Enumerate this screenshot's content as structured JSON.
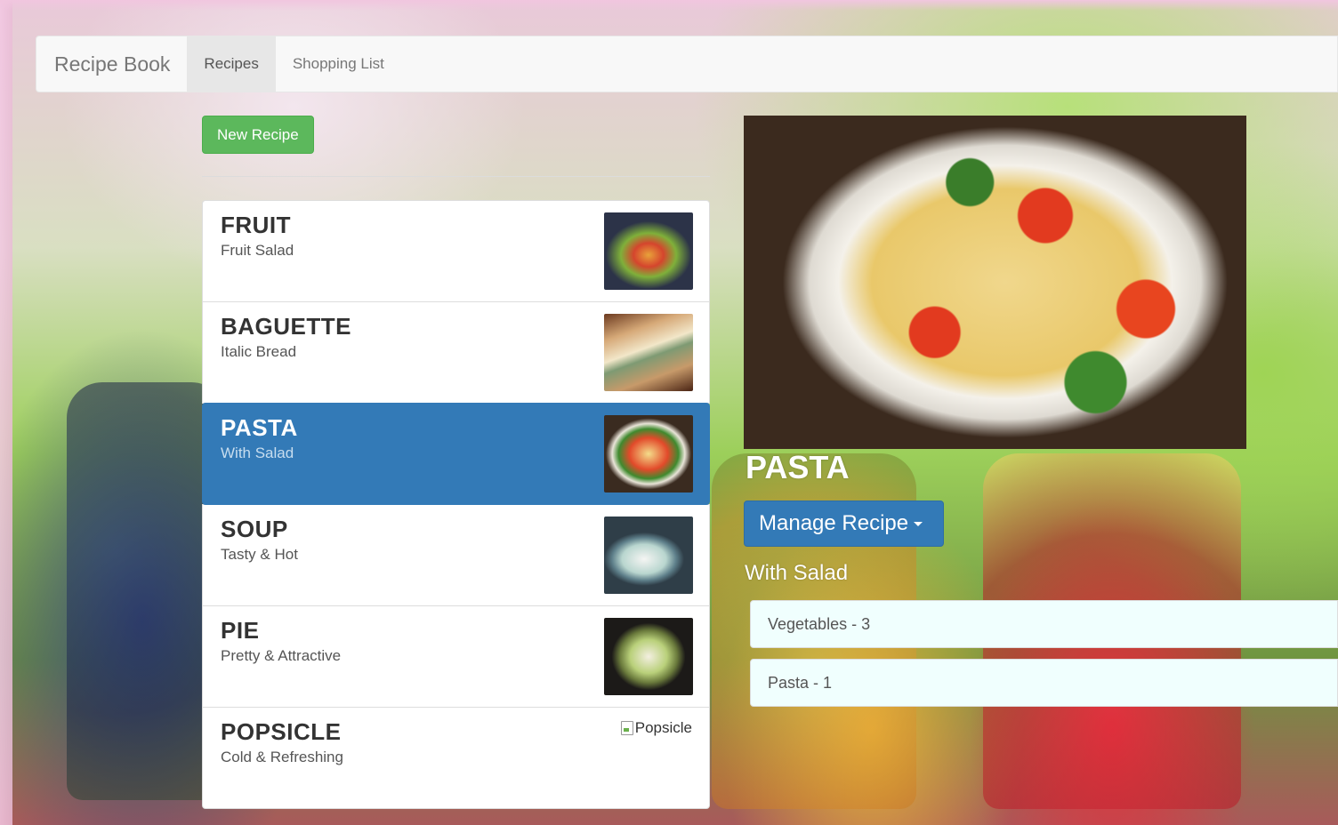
{
  "navbar": {
    "brand": "Recipe Book",
    "links": [
      {
        "label": "Recipes",
        "active": true
      },
      {
        "label": "Shopping List",
        "active": false
      }
    ]
  },
  "recipes_panel": {
    "new_button_label": "New Recipe",
    "recipes": [
      {
        "name": "FRUIT",
        "description": "Fruit Salad",
        "active": false,
        "image": "fruit-salad-photo"
      },
      {
        "name": "BAGUETTE",
        "description": "Italic Bread",
        "active": false,
        "image": "baguette-photo"
      },
      {
        "name": "PASTA",
        "description": "With Salad",
        "active": true,
        "image": "pasta-photo"
      },
      {
        "name": "SOUP",
        "description": "Tasty & Hot",
        "active": false,
        "image": "soup-photo"
      },
      {
        "name": "PIE",
        "description": "Pretty & Attractive",
        "active": false,
        "image": "pie-photo"
      },
      {
        "name": "POPSICLE",
        "description": "Cold & Refreshing",
        "active": false,
        "image_alt": "Popsicle"
      }
    ]
  },
  "detail": {
    "title": "PASTA",
    "manage_label": "Manage Recipe",
    "description": "With Salad",
    "ingredients": [
      "Vegetables - 3",
      "Pasta - 1"
    ]
  },
  "colors": {
    "primary": "#337ab7",
    "success": "#5cb85c",
    "ingredient_bg": "#f0fffe"
  }
}
